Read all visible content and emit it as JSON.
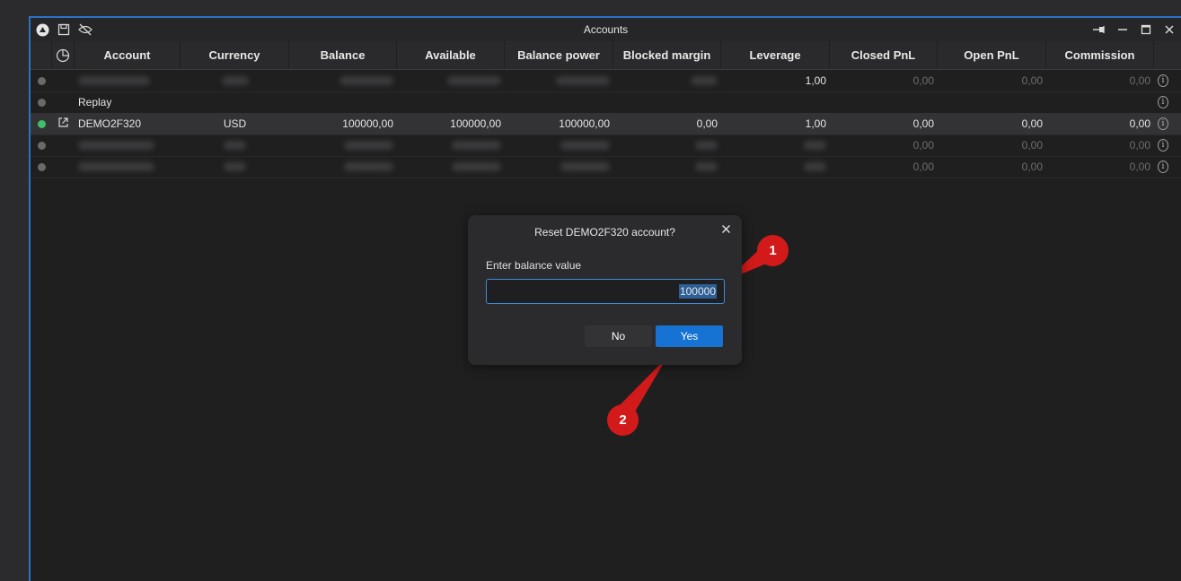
{
  "window": {
    "title": "Accounts",
    "icons": [
      "app-logo-icon",
      "save-icon",
      "hide-icon"
    ],
    "controls": [
      "pin-icon",
      "minimize-icon",
      "maximize-icon",
      "close-icon"
    ]
  },
  "table": {
    "headers": [
      "Account",
      "Currency",
      "Balance",
      "Available",
      "Balance power",
      "Blocked margin",
      "Leverage",
      "Closed PnL",
      "Open PnL",
      "Commission"
    ],
    "rows": [
      {
        "status": "grey",
        "account": "",
        "currency": "",
        "balance": "",
        "available": "",
        "balance_power": "",
        "blocked_margin": "",
        "leverage": "1,00",
        "closed_pnl": "0,00",
        "open_pnl": "0,00",
        "commission": "0,00"
      },
      {
        "status": "grey",
        "account": "Replay",
        "currency": "",
        "balance": "",
        "available": "",
        "balance_power": "",
        "blocked_margin": "",
        "leverage": "",
        "closed_pnl": "",
        "open_pnl": "",
        "commission": ""
      },
      {
        "status": "green",
        "account": "DEMO2F320",
        "currency": "USD",
        "balance": "100000,00",
        "available": "100000,00",
        "balance_power": "100000,00",
        "blocked_margin": "0,00",
        "leverage": "1,00",
        "closed_pnl": "0,00",
        "open_pnl": "0,00",
        "commission": "0,00"
      },
      {
        "status": "grey",
        "account": "",
        "currency": "",
        "balance": "",
        "available": "",
        "balance_power": "",
        "blocked_margin": "",
        "leverage": "",
        "closed_pnl": "0,00",
        "open_pnl": "0,00",
        "commission": "0,00"
      },
      {
        "status": "grey",
        "account": "",
        "currency": "",
        "balance": "",
        "available": "",
        "balance_power": "",
        "blocked_margin": "",
        "leverage": "",
        "closed_pnl": "0,00",
        "open_pnl": "0,00",
        "commission": "0,00"
      }
    ]
  },
  "dialog": {
    "title": "Reset DEMO2F320 account?",
    "label": "Enter balance value",
    "value": "100000",
    "no_label": "No",
    "yes_label": "Yes"
  },
  "annotations": {
    "one": "1",
    "two": "2"
  },
  "colors": {
    "accent": "#1673d3",
    "annotation": "#d21a1a",
    "status_active": "#3fbf6a"
  }
}
